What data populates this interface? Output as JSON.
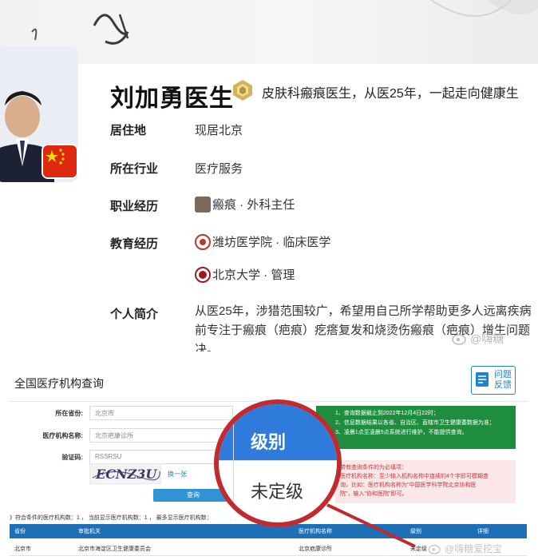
{
  "profile": {
    "name": "刘加勇医生",
    "tagline": "皮肤科瘢痕医生，从医25年，一起走向健康生",
    "fields": [
      {
        "label": "居住地",
        "value": "现居北京"
      },
      {
        "label": "所在行业",
        "value": "医疗服务"
      },
      {
        "label": "职业经历",
        "value": "瘢痕 · 外科主任"
      },
      {
        "label": "教育经历",
        "value": "潍坊医学院 · 临床医学"
      },
      {
        "label": "",
        "value": "北京大学 · 管理"
      },
      {
        "label": "个人简介",
        "value": ""
      }
    ],
    "bio_lines": [
      "从医25年，涉猎范围较广，希望用自己所学帮助更多人远离疾病",
      "前专注于瘢痕（疤痕）疙瘩复发和烧烫伤瘢痕（疤痕）增生问题",
      "决。"
    ],
    "watermark": "@嗨糖"
  },
  "query": {
    "title": "全国医疗机构查询",
    "feedback_line1": "问题",
    "feedback_line2": "反馈",
    "form": {
      "province_label": "所在省份:",
      "province_value": "北京市",
      "org_label": "医疗机构名称:",
      "org_value": "北京疤康诊所",
      "captcha_label": "验证码:",
      "captcha_value": "RSSRSU",
      "captcha_image_text": "ECNZ3U",
      "refresh_label": "换一张",
      "search_button": "查询"
    },
    "notice": [
      "1、查询数据截止到2022年12月4日22时；",
      "2、信息数据结果以各省、自治区、直辖市卫生健康委数据为准；",
      "3、凌晨1点至凌晨5点系统进行维护，不能提供查询。"
    ],
    "hint": [
      "带有查询条件的为必填项：",
      "医疗机构名称：至少输入机构名称中连续的4个字即可模糊查",
      "询，比如：医疗机构名称为\"中国医学科学院北京协和医",
      "院\"，输入\"协和医院\"即可。"
    ],
    "result_summary": "》符合条件的医疗机构数：1 ， 当前显示医疗机构数：1 ， 最多显示医疗机构数：",
    "table": {
      "headers": [
        "省份",
        "审批机关",
        "医疗机构名称",
        "级别",
        "详细"
      ],
      "rows": [
        [
          "北京市",
          "北京市海淀区卫生健康委员会",
          "北京疤康诊所",
          "未定级",
          ""
        ]
      ]
    },
    "magnifier": {
      "header": "级别",
      "value": "未定级"
    },
    "watermark": "@嗨糖爱挖宝"
  },
  "colors": {
    "magnifier_ring": "#c12a2f",
    "table_header": "#1f6fb7",
    "notice_green": "#1e8e3e",
    "hint_pink": "#fbe7e7",
    "link_blue": "#1f84c6"
  },
  "icons": [
    "gold-medal-icon",
    "china-flag-icon",
    "university-seal-icon",
    "scar-thumbnail-icon",
    "feedback-icon",
    "weibo-icon"
  ]
}
